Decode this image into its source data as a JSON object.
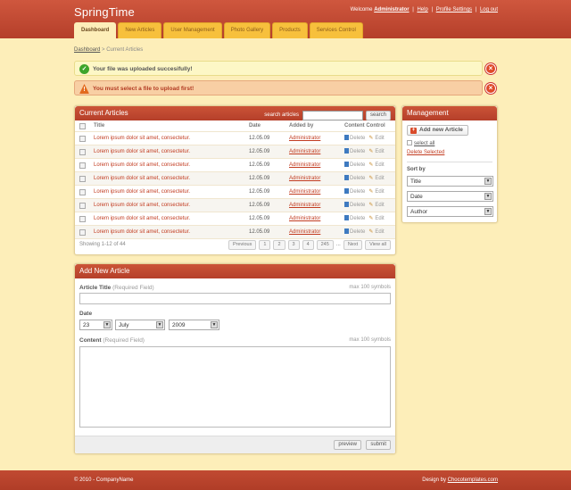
{
  "header": {
    "logo": "SpringTime",
    "welcome": "Welcome",
    "user": "Administrator",
    "sep": "|",
    "links": [
      "Help",
      "Profile Settings",
      "Log out"
    ]
  },
  "tabs": [
    "Dashboard",
    "New Articles",
    "User Management",
    "Photo Gallery",
    "Products",
    "Services Control"
  ],
  "breadcrumb": {
    "root": "Dashboard",
    "sep": ">",
    "current": "Current Articles"
  },
  "messages": {
    "success": "Your file was uploaded succesifully!",
    "error": "You must select a file to upload first!",
    "close": "×"
  },
  "articles": {
    "title": "Current Articles",
    "search_label": "search articles",
    "search_button": "search",
    "columns": {
      "title": "Title",
      "date": "Date",
      "added_by": "Added by",
      "control": "Content Control"
    },
    "delete_label": "Delete",
    "edit_label": "Edit",
    "rows": [
      {
        "title": "Lorem ipsum dolor sit amet, consectetur.",
        "date": "12.05.09",
        "user": "Administrator"
      },
      {
        "title": "Lorem ipsum dolor sit amet, consectetur.",
        "date": "12.05.09",
        "user": "Administrator"
      },
      {
        "title": "Lorem ipsum dolor sit amet, consectetur.",
        "date": "12.05.09",
        "user": "Administrator"
      },
      {
        "title": "Lorem ipsum dolor sit amet, consectetur.",
        "date": "12.05.09",
        "user": "Administrator"
      },
      {
        "title": "Lorem ipsum dolor sit amet, consectetur.",
        "date": "12.05.09",
        "user": "Administrator"
      },
      {
        "title": "Lorem ipsum dolor sit amet, consectetur.",
        "date": "12.05.09",
        "user": "Administrator"
      },
      {
        "title": "Lorem ipsum dolor sit amet, consectetur.",
        "date": "12.05.09",
        "user": "Administrator"
      },
      {
        "title": "Lorem ipsum dolor sit amet, consectetur.",
        "date": "12.05.09",
        "user": "Administrator"
      }
    ],
    "showing": "Showing 1-12 of 44",
    "pager": {
      "previous": "Previous",
      "pages": [
        "1",
        "2",
        "3",
        "4"
      ],
      "dots": "...",
      "last": "245",
      "next": "Next",
      "view_all": "View all"
    }
  },
  "management": {
    "title": "Management",
    "add_button": "Add new Article",
    "plus": "+",
    "select_all": "select all",
    "delete_selected": "Delete Selected",
    "sort_by": "Sort by",
    "sort_options": [
      "Title",
      "Date",
      "Author"
    ]
  },
  "add_article": {
    "title": "Add New Article",
    "article_title_label": "Article Title",
    "required": "(Required Field)",
    "max_title": "max 100 symbols",
    "date_label": "Date",
    "day": "23",
    "month": "July",
    "year": "2009",
    "content_label": "Content",
    "max_content": "max 100 symbols",
    "preview": "preview",
    "submit": "submit"
  },
  "footer": {
    "copyright": "© 2010 - CompanyName",
    "design_by": "Design by",
    "designer": "Chocotemplates.com"
  }
}
